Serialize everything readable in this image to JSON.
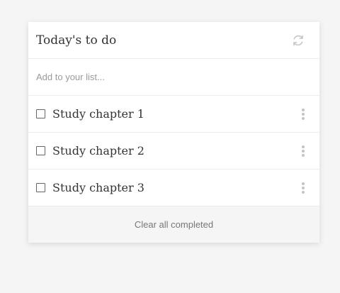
{
  "header": {
    "title": "Today's to do",
    "refresh_icon": "refresh-icon"
  },
  "add": {
    "placeholder": "Add to your list..."
  },
  "items": [
    {
      "label": "Study chapter 1",
      "checked": false
    },
    {
      "label": "Study chapter 2",
      "checked": false
    },
    {
      "label": "Study chapter 3",
      "checked": false
    }
  ],
  "footer": {
    "clear_label": "Clear all completed"
  },
  "colors": {
    "background": "#f5f5f5",
    "card": "#ffffff",
    "text": "#333333",
    "muted": "#9a9a9a",
    "icon": "#c4c4c4"
  }
}
